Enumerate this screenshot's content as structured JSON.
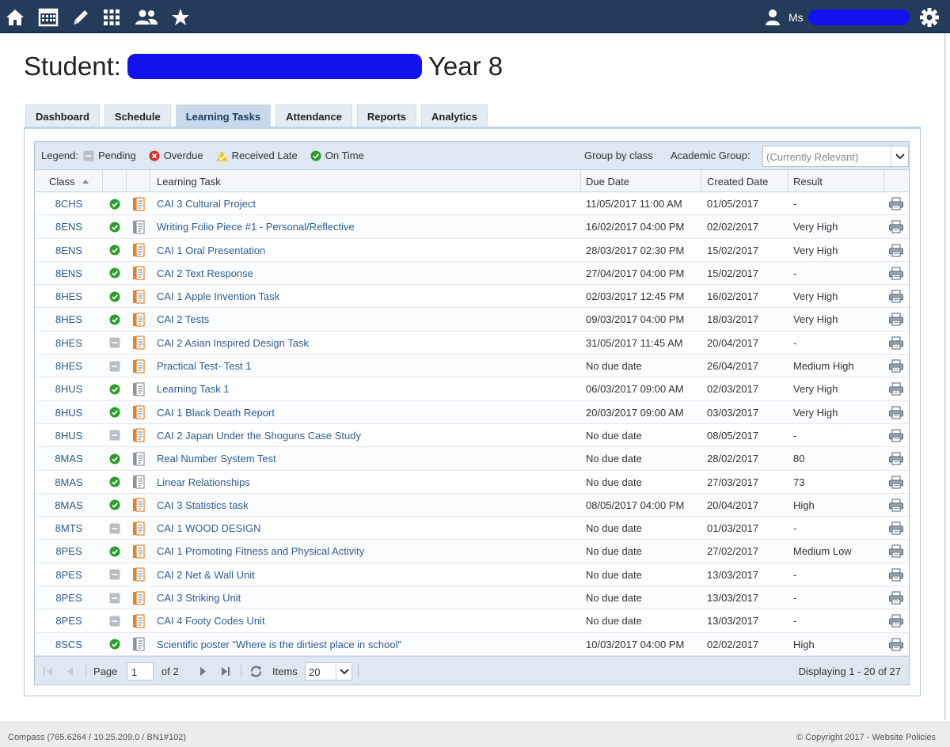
{
  "nav": {
    "icons": [
      "home-icon",
      "calendar-icon",
      "pencil-icon",
      "apps-grid-icon",
      "people-icon",
      "star-icon"
    ],
    "user_prefix": "Ms"
  },
  "title": {
    "prefix": "Student:",
    "suffix": "Year 8"
  },
  "tabs": [
    {
      "label": "Dashboard",
      "active": false
    },
    {
      "label": "Schedule",
      "active": false
    },
    {
      "label": "Learning Tasks",
      "active": true
    },
    {
      "label": "Attendance",
      "active": false
    },
    {
      "label": "Reports",
      "active": false
    },
    {
      "label": "Analytics",
      "active": false
    }
  ],
  "legend": {
    "label": "Legend:",
    "pending": "Pending",
    "overdue": "Overdue",
    "received_late": "Received Late",
    "on_time": "On Time"
  },
  "group_by": "Group by class",
  "academic_group": {
    "label": "Academic Group:",
    "value": "(Currently Relevant)"
  },
  "columns": {
    "class": "Class",
    "task": "Learning Task",
    "due": "Due Date",
    "created": "Created Date",
    "result": "Result"
  },
  "rows": [
    {
      "class": "8CHS",
      "status": "on-time",
      "doc": "orange",
      "task": "CAI 3 Cultural Project",
      "due": "11/05/2017 11:00 AM",
      "created": "01/05/2017",
      "result": "-"
    },
    {
      "class": "8ENS",
      "status": "on-time",
      "doc": "gray",
      "task": "Writing Folio Piece #1 - Personal/Reflective",
      "due": "16/02/2017 04:00 PM",
      "created": "02/02/2017",
      "result": "Very High"
    },
    {
      "class": "8ENS",
      "status": "on-time",
      "doc": "orange",
      "task": "CAI 1 Oral Presentation",
      "due": "28/03/2017 02:30 PM",
      "created": "15/02/2017",
      "result": "Very High"
    },
    {
      "class": "8ENS",
      "status": "on-time",
      "doc": "orange",
      "task": "CAI 2 Text Response",
      "due": "27/04/2017 04:00 PM",
      "created": "15/02/2017",
      "result": "-"
    },
    {
      "class": "8HES",
      "status": "on-time",
      "doc": "orange",
      "task": "CAI 1 Apple Invention Task",
      "due": "02/03/2017 12:45 PM",
      "created": "16/02/2017",
      "result": "Very High"
    },
    {
      "class": "8HES",
      "status": "on-time",
      "doc": "orange",
      "task": "CAI 2 Tests",
      "due": "09/03/2017 04:00 PM",
      "created": "18/03/2017",
      "result": "Very High"
    },
    {
      "class": "8HES",
      "status": "pending",
      "doc": "orange",
      "task": "CAI 2 Asian Inspired Design Task",
      "due": "31/05/2017 11:45 AM",
      "created": "20/04/2017",
      "result": "-"
    },
    {
      "class": "8HES",
      "status": "pending",
      "doc": "orange",
      "task": "Practical Test- Test 1",
      "due": "No due date",
      "created": "26/04/2017",
      "result": "Medium High"
    },
    {
      "class": "8HUS",
      "status": "on-time",
      "doc": "gray",
      "task": "Learning Task 1",
      "due": "06/03/2017 09:00 AM",
      "created": "02/03/2017",
      "result": "Very High"
    },
    {
      "class": "8HUS",
      "status": "on-time",
      "doc": "orange",
      "task": "CAI 1 Black Death Report",
      "due": "20/03/2017 09:00 AM",
      "created": "03/03/2017",
      "result": "Very High"
    },
    {
      "class": "8HUS",
      "status": "pending",
      "doc": "orange",
      "task": "CAI 2 Japan Under the Shoguns Case Study",
      "due": "No due date",
      "created": "08/05/2017",
      "result": "-"
    },
    {
      "class": "8MAS",
      "status": "on-time",
      "doc": "gray",
      "task": "Real Number System Test",
      "due": "No due date",
      "created": "28/02/2017",
      "result": "80"
    },
    {
      "class": "8MAS",
      "status": "on-time",
      "doc": "gray",
      "task": "Linear Relationships",
      "due": "No due date",
      "created": "27/03/2017",
      "result": "73"
    },
    {
      "class": "8MAS",
      "status": "on-time",
      "doc": "orange",
      "task": "CAI 3 Statistics task",
      "due": "08/05/2017 04:00 PM",
      "created": "20/04/2017",
      "result": "High"
    },
    {
      "class": "8MTS",
      "status": "pending",
      "doc": "orange",
      "task": "CAI 1 WOOD DESIGN",
      "due": "No due date",
      "created": "01/03/2017",
      "result": "-"
    },
    {
      "class": "8PES",
      "status": "on-time",
      "doc": "orange",
      "task": "CAI 1 Promoting Fitness and Physical Activity",
      "due": "No due date",
      "created": "27/02/2017",
      "result": "Medium Low"
    },
    {
      "class": "8PES",
      "status": "pending",
      "doc": "orange",
      "task": "CAI 2 Net & Wall Unit",
      "due": "No due date",
      "created": "13/03/2017",
      "result": "-"
    },
    {
      "class": "8PES",
      "status": "pending",
      "doc": "orange",
      "task": "CAI 3 Striking Unit",
      "due": "No due date",
      "created": "13/03/2017",
      "result": "-"
    },
    {
      "class": "8PES",
      "status": "pending",
      "doc": "orange",
      "task": "CAI 4 Footy Codes Unit",
      "due": "No due date",
      "created": "13/03/2017",
      "result": "-"
    },
    {
      "class": "8SCS",
      "status": "on-time",
      "doc": "gray",
      "task": "Scientific poster \"Where is the dirtiest place in school\"",
      "due": "10/03/2017 04:00 PM",
      "created": "02/02/2017",
      "result": "High"
    }
  ],
  "pager": {
    "page_label": "Page",
    "page_value": "1",
    "of_label": "of 2",
    "items_label": "Items",
    "items_value": "20",
    "displaying": "Displaying 1 - 20 of 27"
  },
  "footer": {
    "version": "Compass (765.6264 / 10.25.209.0 / BN1#102)",
    "copyright": "© Copyright 2017 - Website Policies"
  },
  "colors": {
    "nav_bg": "#243b5c",
    "link": "#2e5d92",
    "on_time": "#2a9d2a",
    "overdue": "#d6312a",
    "late": "#f0c419",
    "pending": "#b9bec4",
    "redaction": "#1212f0"
  }
}
